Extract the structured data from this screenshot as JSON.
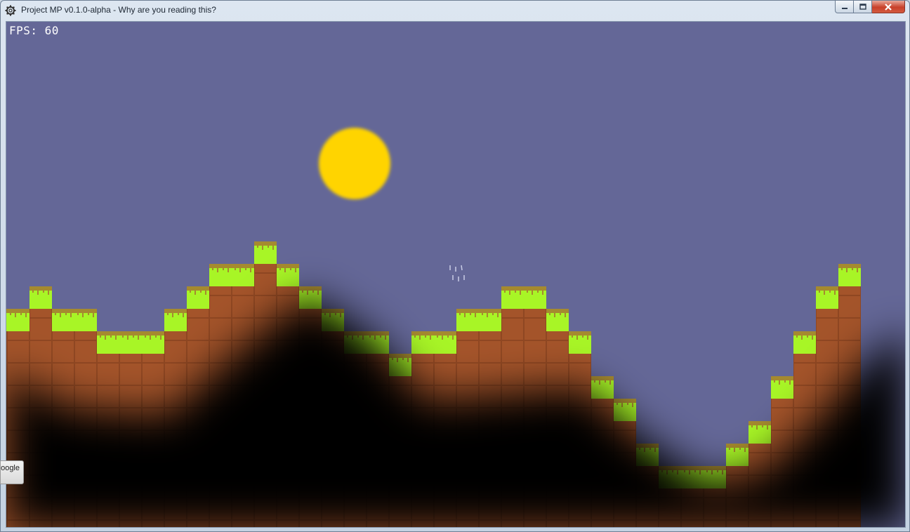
{
  "window": {
    "title": "Project MP v0.1.0-alpha - Why are you reading this?",
    "app_icon": "gear-icon",
    "buttons": {
      "minimize_icon": "minimize-icon",
      "maximize_icon": "maximize-icon",
      "close_icon": "close-icon"
    }
  },
  "hud": {
    "fps_text": "FPS: 60"
  },
  "scene": {
    "sky_color": "#646797",
    "sun_color": "#ffd400",
    "dirt_color": "#a4542a",
    "grass_color": "#a8f526",
    "grass_cap_color": "#a58a2f",
    "darkness_color": "#000000",
    "terrain_surface_rows": [
      2,
      2,
      1,
      2,
      2,
      3,
      3,
      3,
      2,
      1,
      0,
      0,
      -1,
      0,
      1,
      2,
      3,
      3,
      4,
      3,
      3,
      2,
      2,
      1,
      1,
      2,
      3,
      5,
      6,
      8,
      9,
      9,
      9,
      8,
      7,
      5,
      3,
      1,
      0
    ]
  },
  "taskbar_tooltip": {
    "text": "oogle"
  }
}
